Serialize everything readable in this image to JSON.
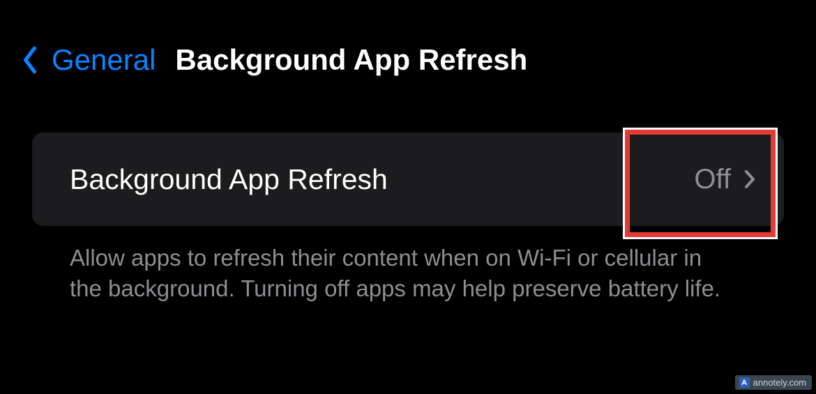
{
  "nav": {
    "back_label": "General",
    "title": "Background App Refresh"
  },
  "setting": {
    "label": "Background App Refresh",
    "value": "Off"
  },
  "description": "Allow apps to refresh their content when on Wi-Fi or cellular in the background. Turning off apps may help preserve battery life.",
  "watermark": {
    "text": "annotely.com",
    "badge": "A"
  },
  "colors": {
    "accent": "#0a84ff",
    "highlight_border": "#e63b34",
    "secondary_text": "#8e8e93",
    "row_bg": "#1c1c1e"
  }
}
